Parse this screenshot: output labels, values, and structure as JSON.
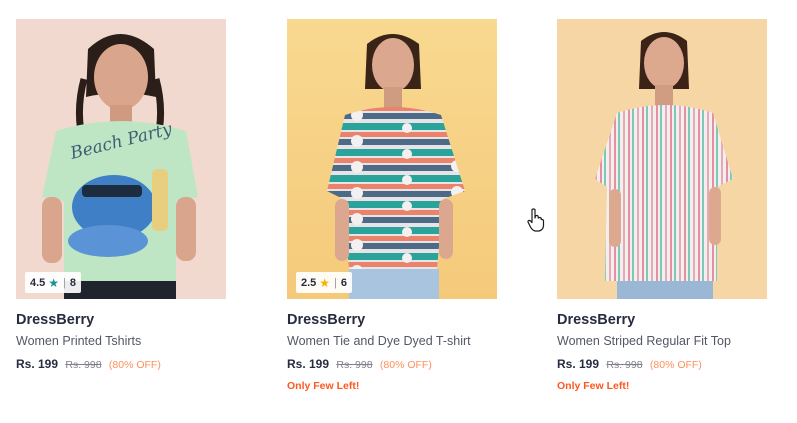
{
  "products": [
    {
      "brand": "DressBerry",
      "name": "Women Printed Tshirts",
      "price": "Rs. 199",
      "mrp": "Rs. 998",
      "discount": "(80% OFF)",
      "rating": "4.5",
      "rating_count": "8",
      "star_color": "#14958f",
      "tag": "",
      "print_text": "Beach Party"
    },
    {
      "brand": "DressBerry",
      "name": "Women Tie and Dye Dyed T-shirt",
      "price": "Rs. 199",
      "mrp": "Rs. 998",
      "discount": "(80% OFF)",
      "rating": "2.5",
      "rating_count": "6",
      "star_color": "#f5b301",
      "tag": "Only Few Left!"
    },
    {
      "brand": "DressBerry",
      "name": "Women Striped Regular Fit Top",
      "price": "Rs. 199",
      "mrp": "Rs. 998",
      "discount": "(80% OFF)",
      "tag": "Only Few Left!"
    }
  ],
  "icons": {
    "star": "star-icon",
    "cursor": "hand-pointer-cursor-icon"
  },
  "colors": {
    "brand_text": "#282c3f",
    "discount": "#ff905a",
    "few_left": "#ff5722"
  }
}
